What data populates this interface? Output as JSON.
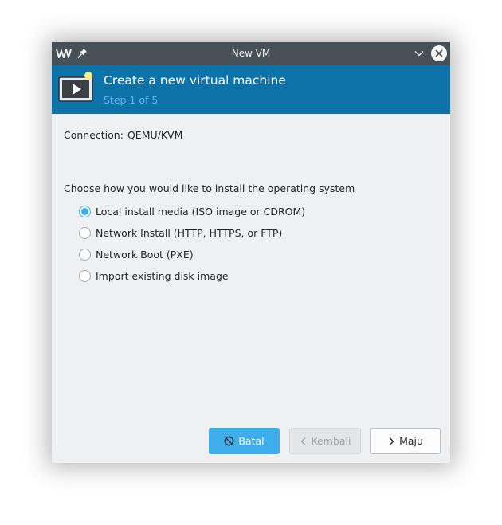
{
  "window": {
    "title": "New VM"
  },
  "header": {
    "title": "Create a new virtual machine",
    "step": "Step 1 of 5"
  },
  "connection": {
    "label": "Connection:",
    "value": "QEMU/KVM"
  },
  "install": {
    "prompt": "Choose how you would like to install the operating system",
    "options": [
      {
        "label": "Local install media (ISO image or CDROM)",
        "checked": true
      },
      {
        "label": "Network Install (HTTP, HTTPS, or FTP)",
        "checked": false
      },
      {
        "label": "Network Boot (PXE)",
        "checked": false
      },
      {
        "label": "Import existing disk image",
        "checked": false
      }
    ]
  },
  "buttons": {
    "cancel": "Batal",
    "back": "Kembali",
    "next": "Maju"
  },
  "colors": {
    "accent": "#3daee9",
    "header_bg": "#0d72a8",
    "titlebar_bg": "#475057"
  },
  "icons": {
    "app": "virt-manager-icon",
    "pin": "pin-icon",
    "minimize": "chevron-down-icon",
    "close": "close-icon",
    "vm": "vm-screen-icon",
    "cancel": "cancel-icon",
    "back": "chevron-left-icon",
    "next": "chevron-right-icon"
  }
}
